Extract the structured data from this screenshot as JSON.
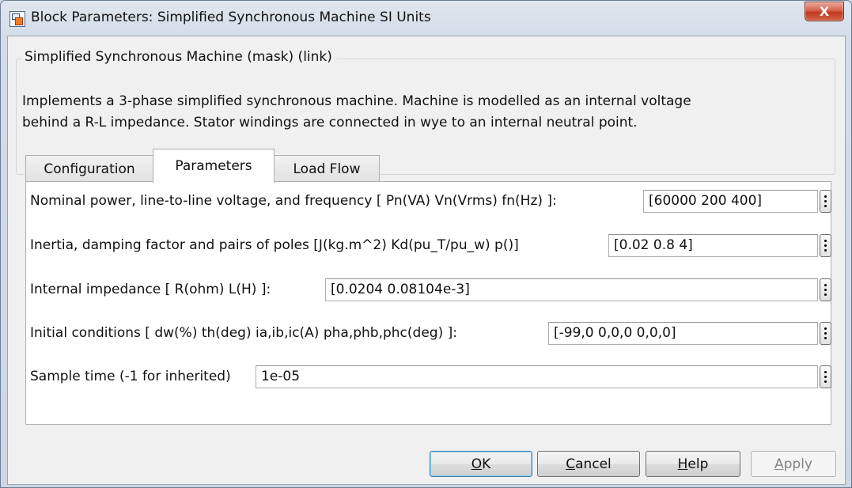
{
  "window": {
    "title": "Block Parameters: Simplified Synchronous Machine SI Units",
    "close_glyph": "X"
  },
  "mask": {
    "legend": "Simplified Synchronous Machine (mask) (link)",
    "description_line1": "Implements a 3-phase simplified synchronous machine. Machine is modelled as an internal voltage",
    "description_line2": "behind a R-L impedance. Stator windings are connected in wye to an internal neutral point."
  },
  "tabs": [
    {
      "label": "Configuration",
      "active": false
    },
    {
      "label": "Parameters",
      "active": true
    },
    {
      "label": "Load Flow",
      "active": false
    }
  ],
  "parameters": [
    {
      "label": "Nominal power, line-to-line voltage, and frequency [ Pn(VA) Vn(Vrms) fn(Hz) ]:",
      "value": "[60000 200 400]"
    },
    {
      "label": "Inertia, damping factor and pairs of poles [J(kg.m^2) Kd(pu_T/pu_w) p()]",
      "value": "[0.02 0.8 4]"
    },
    {
      "label": "Internal impedance [ R(ohm)  L(H) ]:",
      "value": "[0.0204  0.08104e-3]"
    },
    {
      "label": "Initial conditions [ dw(%)  th(deg)  ia,ib,ic(A)  pha,phb,phc(deg) ]:",
      "value": "[-99,0 0,0,0 0,0,0]"
    },
    {
      "label": "Sample time (-1 for inherited)",
      "value": "1e-05"
    }
  ],
  "buttons": {
    "ok": {
      "mnemonic": "O",
      "rest": "K"
    },
    "cancel": {
      "mnemonic": "C",
      "rest": "ancel"
    },
    "help": {
      "mnemonic": "H",
      "rest": "elp"
    },
    "apply": {
      "mnemonic": "A",
      "rest": "pply",
      "enabled": false
    }
  }
}
